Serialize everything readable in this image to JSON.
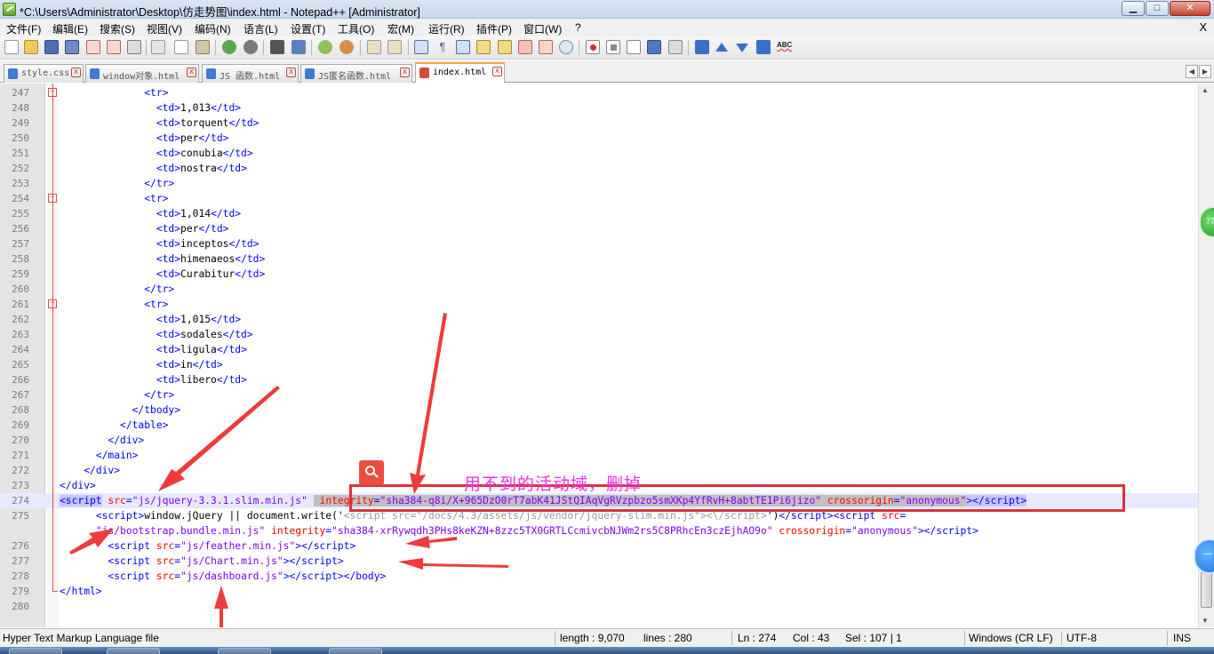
{
  "window": {
    "title": "*C:\\Users\\Administrator\\Desktop\\仿走势图\\index.html - Notepad++ [Administrator]",
    "min_label": "▁",
    "max_label": "□",
    "close_label": "✕"
  },
  "menu": {
    "items": [
      {
        "label": "文件(F)"
      },
      {
        "label": "编辑(E)"
      },
      {
        "label": "搜索(S)"
      },
      {
        "label": "视图(V)"
      },
      {
        "label": "编码(N)"
      },
      {
        "label": "语言(L)"
      },
      {
        "label": "设置(T)"
      },
      {
        "label": "工具(O)"
      },
      {
        "label": "宏(M)"
      },
      {
        "label": "运行(R)"
      },
      {
        "label": "插件(P)"
      },
      {
        "label": "窗口(W)"
      },
      {
        "label": "?"
      }
    ],
    "close_label": "X"
  },
  "toolbar": {
    "icons": [
      "new-file-icon",
      "open-file-icon",
      "save-icon",
      "save-all-icon",
      "close-icon",
      "close-all-icon",
      "print-icon",
      "cut-icon",
      "copy-icon",
      "paste-icon",
      "undo-icon",
      "redo-icon",
      "find-icon",
      "replace-icon",
      "zoom-in-icon",
      "zoom-out-icon",
      "sync-vertical-icon",
      "sync-horizontal-icon",
      "word-wrap-icon",
      "show-all-chars-icon",
      "indent-guide-icon",
      "doc-map-icon",
      "function-list-icon",
      "folder-workspace-icon",
      "monitoring-icon",
      "record-macro-icon",
      "stop-record-icon",
      "play-macro-icon",
      "run-macro-multiple-icon",
      "save-macro-icon",
      "collapse-icon",
      "up-icon",
      "down-icon",
      "expand-icon",
      "spell-check-icon"
    ],
    "spell_label": "ABC"
  },
  "tabs": [
    {
      "label": "style.css",
      "active": false
    },
    {
      "label": "window对象.html",
      "active": false
    },
    {
      "label": "JS 函数.html",
      "active": false
    },
    {
      "label": "JS匿名函数.html",
      "active": false
    },
    {
      "label": "index.html",
      "active": true
    }
  ],
  "tab_close_label": "x",
  "editor": {
    "lines": [
      {
        "n": "247",
        "html": "              <span class=\"tag\">&lt;tr&gt;</span>"
      },
      {
        "n": "248",
        "html": "                <span class=\"tag\">&lt;td&gt;</span>1,013<span class=\"tag\">&lt;/td&gt;</span>"
      },
      {
        "n": "249",
        "html": "                <span class=\"tag\">&lt;td&gt;</span>torquent<span class=\"tag\">&lt;/td&gt;</span>"
      },
      {
        "n": "250",
        "html": "                <span class=\"tag\">&lt;td&gt;</span>per<span class=\"tag\">&lt;/td&gt;</span>"
      },
      {
        "n": "251",
        "html": "                <span class=\"tag\">&lt;td&gt;</span>conubia<span class=\"tag\">&lt;/td&gt;</span>"
      },
      {
        "n": "252",
        "html": "                <span class=\"tag\">&lt;td&gt;</span>nostra<span class=\"tag\">&lt;/td&gt;</span>"
      },
      {
        "n": "253",
        "html": "              <span class=\"tag\">&lt;/tr&gt;</span>"
      },
      {
        "n": "254",
        "html": "              <span class=\"tag\">&lt;tr&gt;</span>"
      },
      {
        "n": "255",
        "html": "                <span class=\"tag\">&lt;td&gt;</span>1,014<span class=\"tag\">&lt;/td&gt;</span>"
      },
      {
        "n": "256",
        "html": "                <span class=\"tag\">&lt;td&gt;</span>per<span class=\"tag\">&lt;/td&gt;</span>"
      },
      {
        "n": "257",
        "html": "                <span class=\"tag\">&lt;td&gt;</span>inceptos<span class=\"tag\">&lt;/td&gt;</span>"
      },
      {
        "n": "258",
        "html": "                <span class=\"tag\">&lt;td&gt;</span>himenaeos<span class=\"tag\">&lt;/td&gt;</span>"
      },
      {
        "n": "259",
        "html": "                <span class=\"tag\">&lt;td&gt;</span>Curabitur<span class=\"tag\">&lt;/td&gt;</span>"
      },
      {
        "n": "260",
        "html": "              <span class=\"tag\">&lt;/tr&gt;</span>"
      },
      {
        "n": "261",
        "html": "              <span class=\"tag\">&lt;tr&gt;</span>"
      },
      {
        "n": "262",
        "html": "                <span class=\"tag\">&lt;td&gt;</span>1,015<span class=\"tag\">&lt;/td&gt;</span>"
      },
      {
        "n": "263",
        "html": "                <span class=\"tag\">&lt;td&gt;</span>sodales<span class=\"tag\">&lt;/td&gt;</span>"
      },
      {
        "n": "264",
        "html": "                <span class=\"tag\">&lt;td&gt;</span>ligula<span class=\"tag\">&lt;/td&gt;</span>"
      },
      {
        "n": "265",
        "html": "                <span class=\"tag\">&lt;td&gt;</span>in<span class=\"tag\">&lt;/td&gt;</span>"
      },
      {
        "n": "266",
        "html": "                <span class=\"tag\">&lt;td&gt;</span>libero<span class=\"tag\">&lt;/td&gt;</span>"
      },
      {
        "n": "267",
        "html": "              <span class=\"tag\">&lt;/tr&gt;</span>"
      },
      {
        "n": "268",
        "html": "            <span class=\"tag\">&lt;/tbody&gt;</span>"
      },
      {
        "n": "269",
        "html": "          <span class=\"tag\">&lt;/table&gt;</span>"
      },
      {
        "n": "270",
        "html": "        <span class=\"tag\">&lt;/div&gt;</span>"
      },
      {
        "n": "271",
        "html": "      <span class=\"tag\">&lt;/main&gt;</span>"
      },
      {
        "n": "272",
        "html": "    <span class=\"tag\">&lt;/div&gt;</span>"
      },
      {
        "n": "273",
        "html": "<span class=\"tag\">&lt;/div&gt;</span>"
      },
      {
        "n": "274",
        "current": true,
        "html": "<span class=\"tag hl-tag\">&lt;script</span> <span class=\"attr\">src</span><span class=\"tag\">=</span><span class=\"val\">\"js/jquery-3.3.1.slim.min.js\"</span> <span class=\"hl-sel\"> <span class=\"attr\">integrity</span><span class=\"tag\">=</span><span class=\"val\">\"sha384-q8i/X+965DzO0rT7abK41JStQIAqVgRVzpbzo5smXKp4YfRvH+8abtTE1Pi6jizo\"</span> <span class=\"attr\">crossorigin</span><span class=\"tag\">=</span><span class=\"val\">\"anonymous\"</span></span><span class=\"tag hl-tag\">&gt;</span><span class=\"tag hl-tag\">&lt;/script&gt;</span>"
      },
      {
        "n": "275",
        "html": "      <span class=\"tag\">&lt;script&gt;</span>window.jQuery || document.write('<span class=\"faded\">&lt;script src=\"/docs/4.3/assets/js/vendor/jquery-slim.min.js\"&gt;&lt;\\/script&gt;</span>')<span class=\"tag\">&lt;/script&gt;&lt;script</span> <span class=\"attr\">src</span><span class=\"tag\">=</span>"
      },
      {
        "n": "",
        "html": "      <span class=\"val\">\"js/bootstrap.bundle.min.js\"</span> <span class=\"attr\">integrity</span><span class=\"tag\">=</span><span class=\"val\">\"sha384-xrRywqdh3PHs8keKZN+8zzc5TX0GRTLCcmivcbNJWm2rs5C8PRhcEn3czEjhAO9o\"</span> <span class=\"attr\">crossorigin</span><span class=\"tag\">=</span><span class=\"val\">\"anonymous\"</span><span class=\"tag\">&gt;&lt;/script&gt;</span>"
      },
      {
        "n": "276",
        "html": "        <span class=\"tag\">&lt;script</span> <span class=\"attr\">src</span><span class=\"tag\">=</span><span class=\"val\">\"js/feather.min.js\"</span><span class=\"tag\">&gt;&lt;/script&gt;</span>"
      },
      {
        "n": "277",
        "html": "        <span class=\"tag\">&lt;script</span> <span class=\"attr\">src</span><span class=\"tag\">=</span><span class=\"val\">\"js/Chart.min.js\"</span><span class=\"tag\">&gt;&lt;/script&gt;</span>"
      },
      {
        "n": "278",
        "html": "        <span class=\"tag\">&lt;script</span> <span class=\"attr\">src</span><span class=\"tag\">=</span><span class=\"val\">\"js/dashboard.js\"</span><span class=\"tag\">&gt;&lt;/script&gt;&lt;/body&gt;</span>"
      },
      {
        "n": "279",
        "html": "<span class=\"tag\">&lt;/html&gt;</span>"
      },
      {
        "n": "280",
        "html": ""
      }
    ]
  },
  "annotation": {
    "text": "用不到的活动域，删掉",
    "color": "#e835e4",
    "box_color": "#e0303a"
  },
  "side_widgets": {
    "green_label": "77",
    "blue_label": "—"
  },
  "status": {
    "file_type": "Hyper Text Markup Language file",
    "length": "length : 9,070",
    "lines": "lines : 280",
    "ln": "Ln : 274",
    "col": "Col : 43",
    "sel": "Sel : 107 | 1",
    "eol": "Windows (CR LF)",
    "encoding": "UTF-8",
    "mode": "INS"
  },
  "colors": {
    "tag": "#0000ff",
    "attr": "#ff0000",
    "value": "#8000ff",
    "current_line": "#e8e8ff",
    "arrow": "#ee3b3b"
  }
}
